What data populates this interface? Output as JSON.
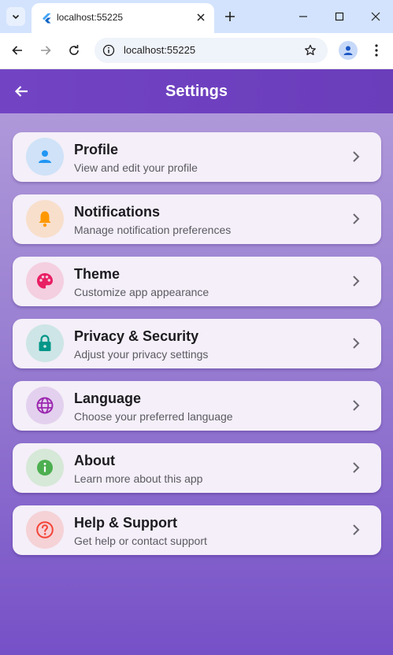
{
  "browser": {
    "tab_title": "localhost:55225",
    "url": "localhost:55225"
  },
  "appbar": {
    "title": "Settings"
  },
  "settings": [
    {
      "title": "Profile",
      "subtitle": "View and edit your profile",
      "icon": "person-icon",
      "icon_color": "#2196f3",
      "icon_bg": "#cfe2f8"
    },
    {
      "title": "Notifications",
      "subtitle": "Manage notification preferences",
      "icon": "bell-icon",
      "icon_color": "#ff9800",
      "icon_bg": "#f8dfcc"
    },
    {
      "title": "Theme",
      "subtitle": "Customize app appearance",
      "icon": "palette-icon",
      "icon_color": "#e91e63",
      "icon_bg": "#f4cfe0"
    },
    {
      "title": "Privacy & Security",
      "subtitle": "Adjust your privacy settings",
      "icon": "lock-icon",
      "icon_color": "#009688",
      "icon_bg": "#cde5e6"
    },
    {
      "title": "Language",
      "subtitle": "Choose your preferred language",
      "icon": "globe-icon",
      "icon_color": "#9c27b0",
      "icon_bg": "#e3d0ee"
    },
    {
      "title": "About",
      "subtitle": "Learn more about this app",
      "icon": "info-icon",
      "icon_color": "#4caf50",
      "icon_bg": "#d6e8d7"
    },
    {
      "title": "Help & Support",
      "subtitle": "Get help or contact support",
      "icon": "help-icon",
      "icon_color": "#f44336",
      "icon_bg": "#f5d2d6"
    }
  ],
  "colors": {
    "appbar": "#6a3dbb",
    "card": "#f4eff8"
  }
}
